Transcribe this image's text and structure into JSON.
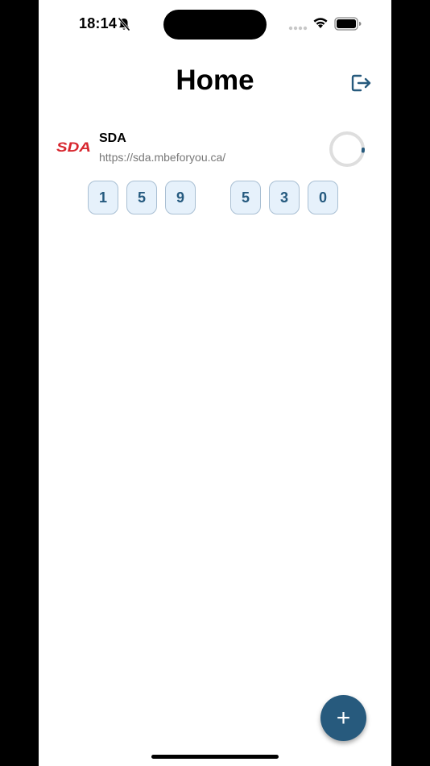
{
  "status_bar": {
    "time": "18:14",
    "icons": [
      "bell-muted-icon",
      "signal-icon",
      "wifi-icon",
      "battery-icon"
    ]
  },
  "header": {
    "title": "Home",
    "logout_icon": "logout-icon"
  },
  "accounts": [
    {
      "logo_text": "SDA",
      "name": "SDA",
      "url": "https://sda.mbeforyou.ca/",
      "code_group_1": [
        "1",
        "5",
        "9"
      ],
      "code_group_2": [
        "5",
        "3",
        "0"
      ],
      "timer_fraction_remaining": 0.02
    }
  ],
  "fab": {
    "label": "+"
  },
  "colors": {
    "accent": "#275a7d",
    "digit_bg": "#e6f1fb",
    "digit_border": "#a9bfd3",
    "digit_text": "#255a7f",
    "logo_red": "#d7262e",
    "url_text": "#777777"
  }
}
